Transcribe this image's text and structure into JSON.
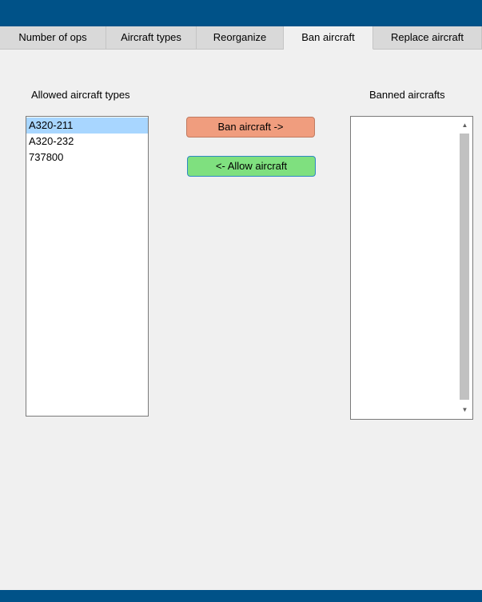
{
  "tabs": [
    {
      "label": "Number of ops"
    },
    {
      "label": "Aircraft types"
    },
    {
      "label": "Reorganize"
    },
    {
      "label": "Ban aircraft"
    },
    {
      "label": "Replace aircraft"
    }
  ],
  "active_tab": "Ban aircraft",
  "allowed": {
    "label": "Allowed aircraft types",
    "items": [
      "A320-211",
      "A320-232",
      "737800"
    ],
    "selected": "A320-211"
  },
  "banned": {
    "label": "Banned aircrafts",
    "items": []
  },
  "buttons": {
    "ban_label": "Ban aircraft ->",
    "allow_label": "<- Allow aircraft"
  },
  "colors": {
    "header_bar": "#005288",
    "ban_button": "#f09d7e",
    "allow_button": "#7fe07f",
    "selection": "#a8d6ff"
  },
  "icons": {
    "scroll_up": "triangle-up",
    "scroll_down": "triangle-down"
  }
}
